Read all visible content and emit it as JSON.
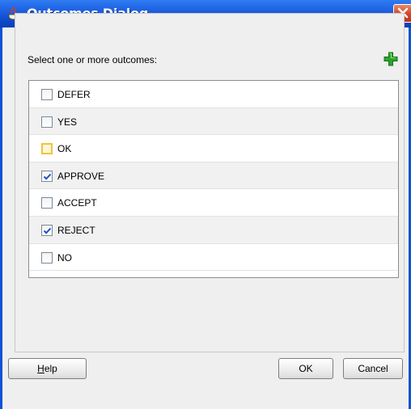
{
  "window": {
    "title": "Outcomes Dialog",
    "title_icon": "java-cup-icon",
    "close_icon": "close-icon"
  },
  "prompt": "Select one or more outcomes:",
  "add_button": {
    "icon": "add-plus-icon",
    "color": "#2aa52a"
  },
  "outcomes": [
    {
      "label": "DEFER",
      "checked": false,
      "focused": false
    },
    {
      "label": "YES",
      "checked": false,
      "focused": false
    },
    {
      "label": "OK",
      "checked": false,
      "focused": true
    },
    {
      "label": "APPROVE",
      "checked": true,
      "focused": false
    },
    {
      "label": "ACCEPT",
      "checked": false,
      "focused": false
    },
    {
      "label": "REJECT",
      "checked": true,
      "focused": false
    },
    {
      "label": "NO",
      "checked": false,
      "focused": false
    }
  ],
  "buttons": {
    "help_mnemonic": "H",
    "help_rest": "elp",
    "ok": "OK",
    "cancel": "Cancel"
  },
  "colors": {
    "titlebar": "#0a47c8",
    "check": "#1f4fc9",
    "focus": "#f3c23c"
  }
}
